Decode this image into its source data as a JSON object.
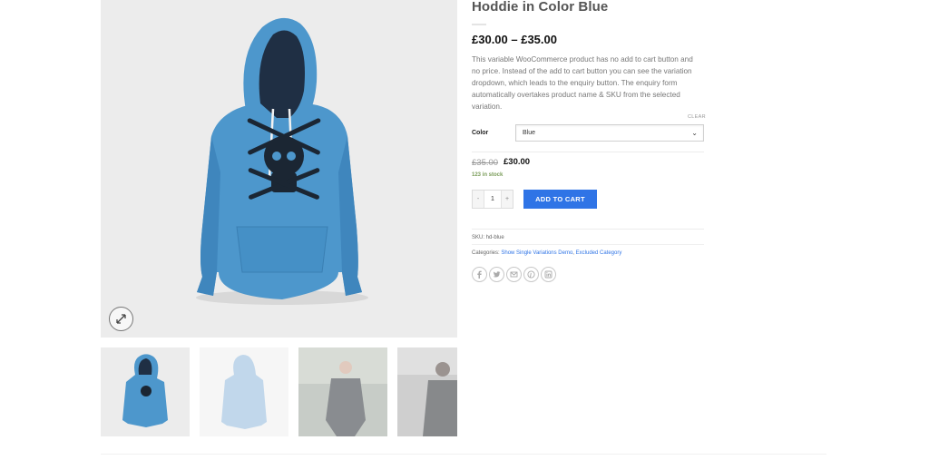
{
  "product": {
    "title": "Hoddie in Color Blue",
    "price_range": "£30.00 – £35.00",
    "description": "This variable WooCommerce product has no add to cart button and no price. Instead of the add to cart button you can see the variation dropdown, which leads to the enquiry button. The enquiry form automatically overtakes product name & SKU from the selected variation."
  },
  "variation": {
    "clear_label": "CLEAR",
    "color_label": "Color",
    "selected": "Blue",
    "old_price": "£35.00",
    "new_price": "£30.00",
    "stock": "123 in stock"
  },
  "cart": {
    "minus": "-",
    "qty": "1",
    "plus": "+",
    "add_label": "ADD TO CART"
  },
  "meta": {
    "sku": "SKU: hd-blue",
    "categories_label": "Categories:",
    "category_1": "Show Single Variations Demo",
    "separator": ",",
    "category_2": "Excluded Category"
  },
  "share_icons": [
    "facebook-icon",
    "twitter-icon",
    "email-icon",
    "pinterest-icon",
    "linkedin-icon"
  ],
  "colors": {
    "accent": "#2f74e6",
    "hoodie": "#4d97cc",
    "stock": "#7a9c59"
  }
}
